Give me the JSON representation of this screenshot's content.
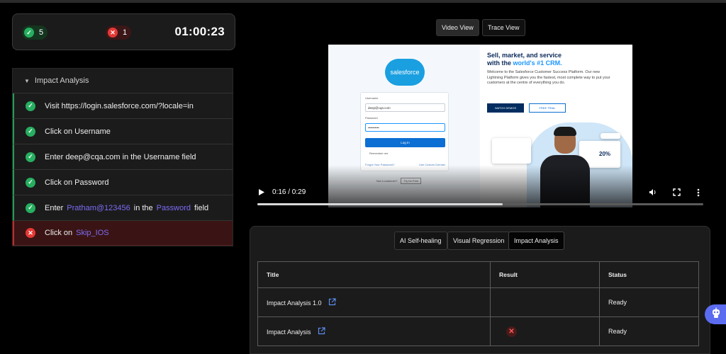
{
  "summary": {
    "passed": "5",
    "failed": "1",
    "timer": "01:00:23"
  },
  "steps_panel": {
    "title": "Impact Analysis",
    "steps": [
      {
        "status": "pass",
        "text": "Visit https://login.salesforce.com/?locale=in"
      },
      {
        "status": "pass",
        "text": "Click on Username"
      },
      {
        "status": "pass",
        "text": "Enter deep@cqa.com in the Username field"
      },
      {
        "status": "pass",
        "text": "Click on Password"
      },
      {
        "status": "pass",
        "text_prefix": "Enter",
        "value": "Pratham@123456",
        "text_mid": "in the",
        "field": "Password",
        "text_suffix": "field"
      },
      {
        "status": "fail",
        "text_prefix": "Click on",
        "target": "Skip_IOS"
      }
    ]
  },
  "view_toggle": {
    "video_view": "Video View",
    "trace_view": "Trace View",
    "active": "Video View"
  },
  "video": {
    "current_time": "0:16",
    "duration": "0:29",
    "time_display": "0:16 / 0:29",
    "progress": 0.55,
    "frame": {
      "logo": "salesforce",
      "username_label": "Username",
      "username_value": "deep@cqa.com",
      "password_label": "Password",
      "password_value": "••••••••••",
      "login_button": "Log In",
      "remember_me": "Remember me",
      "forgot_password": "Forgot Your Password?",
      "custom_domain": "Use Custom Domain",
      "not_customer": "Not a customer?",
      "try_free": "Try for Free",
      "headline_1": "Sell, market, and service",
      "headline_2_prefix": "with the ",
      "headline_2_accent": "world's #1 CRM.",
      "blurb": "Welcome to the Salesforce Customer Success Platform. Our new Lightning Platform gives you the fastest, most complete way to put your customers at the centre of everything you do.",
      "watch_demos": "WATCH DEMOS",
      "free_trial": "FREE TRIAL",
      "stat": "20%"
    }
  },
  "analysis_tabs": {
    "tabs": [
      "AI Self-healing",
      "Visual Regression",
      "Impact Analysis"
    ],
    "active": "Impact Analysis"
  },
  "results_table": {
    "columns": [
      "Title",
      "Result",
      "Status"
    ],
    "rows": [
      {
        "title": "Impact Analysis 1.0",
        "result": "",
        "status": "Ready"
      },
      {
        "title": "Impact Analysis",
        "result": "fail",
        "status": "Ready"
      }
    ]
  },
  "colors": {
    "pass": "#27ae60",
    "fail": "#e53935",
    "highlight": "#7c6cf5",
    "fab": "#5b6cf0"
  }
}
